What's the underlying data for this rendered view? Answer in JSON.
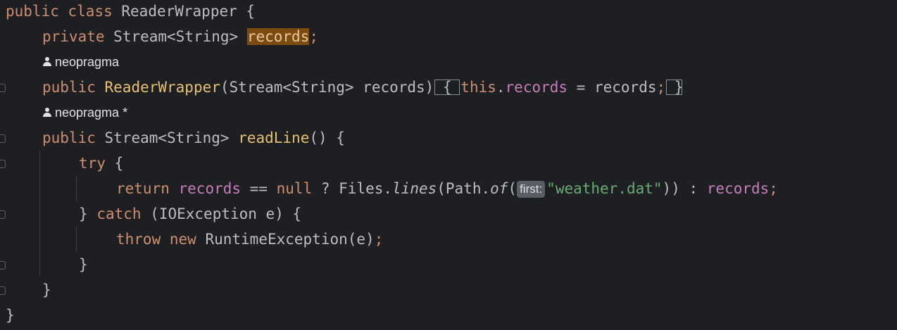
{
  "editor": {
    "language": "java",
    "lines": {
      "l1": [
        "public",
        "class",
        "ReaderWrapper",
        "{"
      ],
      "l2": [
        "private",
        "Stream<String>",
        "records",
        ";"
      ],
      "l3_author": "neopragma",
      "l4": [
        "public",
        "ReaderWrapper",
        "(Stream<String> records)",
        "{",
        "this",
        ".",
        "records",
        " = records",
        ";",
        "}"
      ],
      "l5_author": "neopragma *",
      "l6": [
        "public",
        "Stream<String>",
        "readLine",
        "() {"
      ],
      "l7": [
        "try",
        "{"
      ],
      "l8": [
        "return",
        "records",
        "==",
        "null",
        "? Files.",
        "lines",
        "(Path.",
        "of",
        "(",
        "first:",
        "\"weather.dat\"",
        ")) :",
        "records",
        ";"
      ],
      "l9": [
        "}",
        "catch",
        "(IOException e) {"
      ],
      "l10": [
        "throw",
        "new",
        "RuntimeException(e)",
        ";"
      ],
      "l11": "}",
      "l12": "}",
      "l13": "}"
    }
  },
  "colors": {
    "background": "#1e1f22",
    "keyword": "#cf8e6d",
    "field": "#c77dbb",
    "method_declaration": "#e8c16e",
    "string": "#6aab73",
    "occurrence_highlight": "#7b4b10"
  }
}
